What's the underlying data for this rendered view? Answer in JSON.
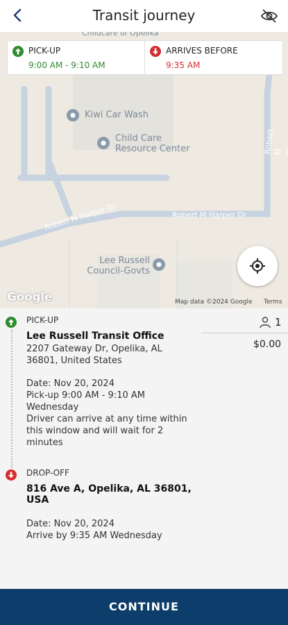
{
  "header": {
    "title": "Transit journey",
    "back_icon": "chevron-left-icon",
    "visibility_icon": "eye-off-icon"
  },
  "map": {
    "pickup_card": {
      "label": "PICK-UP",
      "time": "9:00 AM - 9:10 AM",
      "icon": "arrow-up-circle-icon",
      "color": "#2e8b2e"
    },
    "arrive_card": {
      "label": "ARRIVES BEFORE",
      "time": "9:35 AM",
      "icon": "arrow-down-circle-icon",
      "color": "#d32f2f"
    },
    "top_poi": "Childcare of Opelika",
    "pois": [
      {
        "name": "Kiwi Car Wash"
      },
      {
        "name": "Child Care Resource Center"
      },
      {
        "name": "Lee Russell Council-Govts"
      }
    ],
    "roads": [
      "Robert M Harper Dr",
      "Robert M Harper Dr",
      "Robert M Harper Dr"
    ],
    "attribution": "Google",
    "map_data": "Map data ©2024 Google",
    "terms": "Terms",
    "locate_icon": "my-location-icon"
  },
  "pickup": {
    "label": "PICK-UP",
    "place": "Lee Russell Transit Office",
    "address_line1": "2207 Gateway Dr, Opelika, AL",
    "address_line2": "36801, United States",
    "date": "Date: Nov 20, 2024",
    "window_line1": "Pick-up 9:00 AM - 9:10 AM",
    "window_line2": "Wednesday",
    "note_line1": "Driver can arrive at any time within",
    "note_line2": "this window and will wait for 2",
    "note_line3": "minutes"
  },
  "dropoff": {
    "label": "DROP-OFF",
    "address_line1": "816 Ave A, Opelika, AL 36801,",
    "address_line2": "USA",
    "date": "Date: Nov 20, 2024",
    "arrive": "Arrive by 9:35 AM Wednesday"
  },
  "summary": {
    "passengers": "1",
    "passenger_icon": "person-icon",
    "price": "$0.00"
  },
  "footer": {
    "continue_label": "CONTINUE",
    "color": "#0d3d6b"
  }
}
